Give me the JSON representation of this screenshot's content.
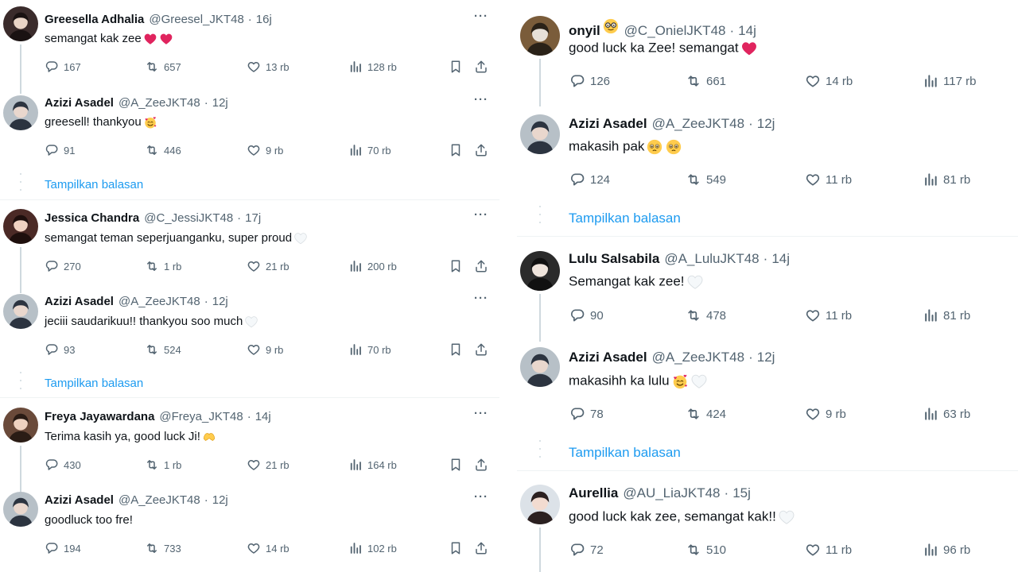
{
  "left": {
    "show_replies_label": "Tampilkan balasan",
    "tweets": [
      {
        "name": "Greesella Adhalia",
        "handle": "@Greesel_JKT48",
        "time": "16j",
        "text": "semangat kak zee",
        "emoji": "red-heart red-heart",
        "replies": "167",
        "retweets": "657",
        "likes": "13 rb",
        "views": "128 rb",
        "avatar": "greesella-avatar"
      },
      {
        "name": "Azizi Asadel",
        "handle": "@A_ZeeJKT48",
        "time": "12j",
        "text": "greesell! thankyou",
        "emoji": "smiling-face-with-hearts",
        "replies": "91",
        "retweets": "446",
        "likes": "9 rb",
        "views": "70 rb",
        "avatar": "azizi-avatar"
      },
      {
        "name": "Jessica Chandra",
        "handle": "@C_JessiJKT48",
        "time": "17j",
        "text": "semangat teman seperjuanganku, super proud",
        "emoji": "white-heart",
        "replies": "270",
        "retweets": "1 rb",
        "likes": "21 rb",
        "views": "200 rb",
        "avatar": "jessica-avatar"
      },
      {
        "name": "Azizi Asadel",
        "handle": "@A_ZeeJKT48",
        "time": "12j",
        "text": "jeciii saudarikuu!! thankyou soo much",
        "emoji": "white-heart",
        "replies": "93",
        "retweets": "524",
        "likes": "9 rb",
        "views": "70 rb",
        "avatar": "azizi-avatar"
      },
      {
        "name": "Freya Jayawardana",
        "handle": "@Freya_JKT48",
        "time": "14j",
        "text": "Terima kasih ya, good luck Ji!",
        "emoji": "heart-hands",
        "replies": "430",
        "retweets": "1 rb",
        "likes": "21 rb",
        "views": "164 rb",
        "avatar": "freya-avatar"
      },
      {
        "name": "Azizi Asadel",
        "handle": "@A_ZeeJKT48",
        "time": "12j",
        "text": "goodluck too fre!",
        "emoji": "",
        "replies": "194",
        "retweets": "733",
        "likes": "14 rb",
        "views": "102 rb",
        "avatar": "azizi-avatar"
      }
    ]
  },
  "right": {
    "show_replies_label": "Tampilkan balasan",
    "tweets": [
      {
        "name": "onyil",
        "handle": "@C_OnielJKT48",
        "time": "14j",
        "text": "good luck ka Zee! semangat",
        "emoji": "red-heart",
        "name_emoji": "nerd-face",
        "replies": "126",
        "retweets": "661",
        "likes": "14 rb",
        "views": "117 rb",
        "avatar": "onyil-avatar"
      },
      {
        "name": "Azizi Asadel",
        "handle": "@A_ZeeJKT48",
        "time": "12j",
        "text": "makasih pak",
        "emoji": "pleading-face pleading-face",
        "replies": "124",
        "retweets": "549",
        "likes": "11 rb",
        "views": "81 rb",
        "avatar": "azizi-avatar"
      },
      {
        "name": "Lulu Salsabila",
        "handle": "@A_LuluJKT48",
        "time": "14j",
        "text": "Semangat kak zee!",
        "emoji": "white-heart",
        "replies": "90",
        "retweets": "478",
        "likes": "11 rb",
        "views": "81 rb",
        "avatar": "lulu-avatar"
      },
      {
        "name": "Azizi Asadel",
        "handle": "@A_ZeeJKT48",
        "time": "12j",
        "text": "makasihh ka lulu",
        "emoji": "smiling-face-with-hearts white-heart",
        "replies": "78",
        "retweets": "424",
        "likes": "9 rb",
        "views": "63 rb",
        "avatar": "azizi-avatar"
      },
      {
        "name": "Aurellia",
        "handle": "@AU_LiaJKT48",
        "time": "15j",
        "text": "good luck kak zee, semangat kak!!",
        "emoji": "white-heart",
        "replies": "72",
        "retweets": "510",
        "likes": "11 rb",
        "views": "96 rb",
        "avatar": "aurellia-avatar"
      }
    ]
  },
  "icons": {
    "reply": "reply-icon",
    "retweet": "retweet-icon",
    "like": "heart-icon",
    "views": "views-icon",
    "bookmark": "bookmark-icon",
    "share": "share-icon",
    "more": "more-icon"
  },
  "colors": {
    "link": "#1d9bf0",
    "muted": "#536471",
    "text": "#0f1419",
    "thread_line": "#cfd9de",
    "heart_red": "#e0245e"
  }
}
